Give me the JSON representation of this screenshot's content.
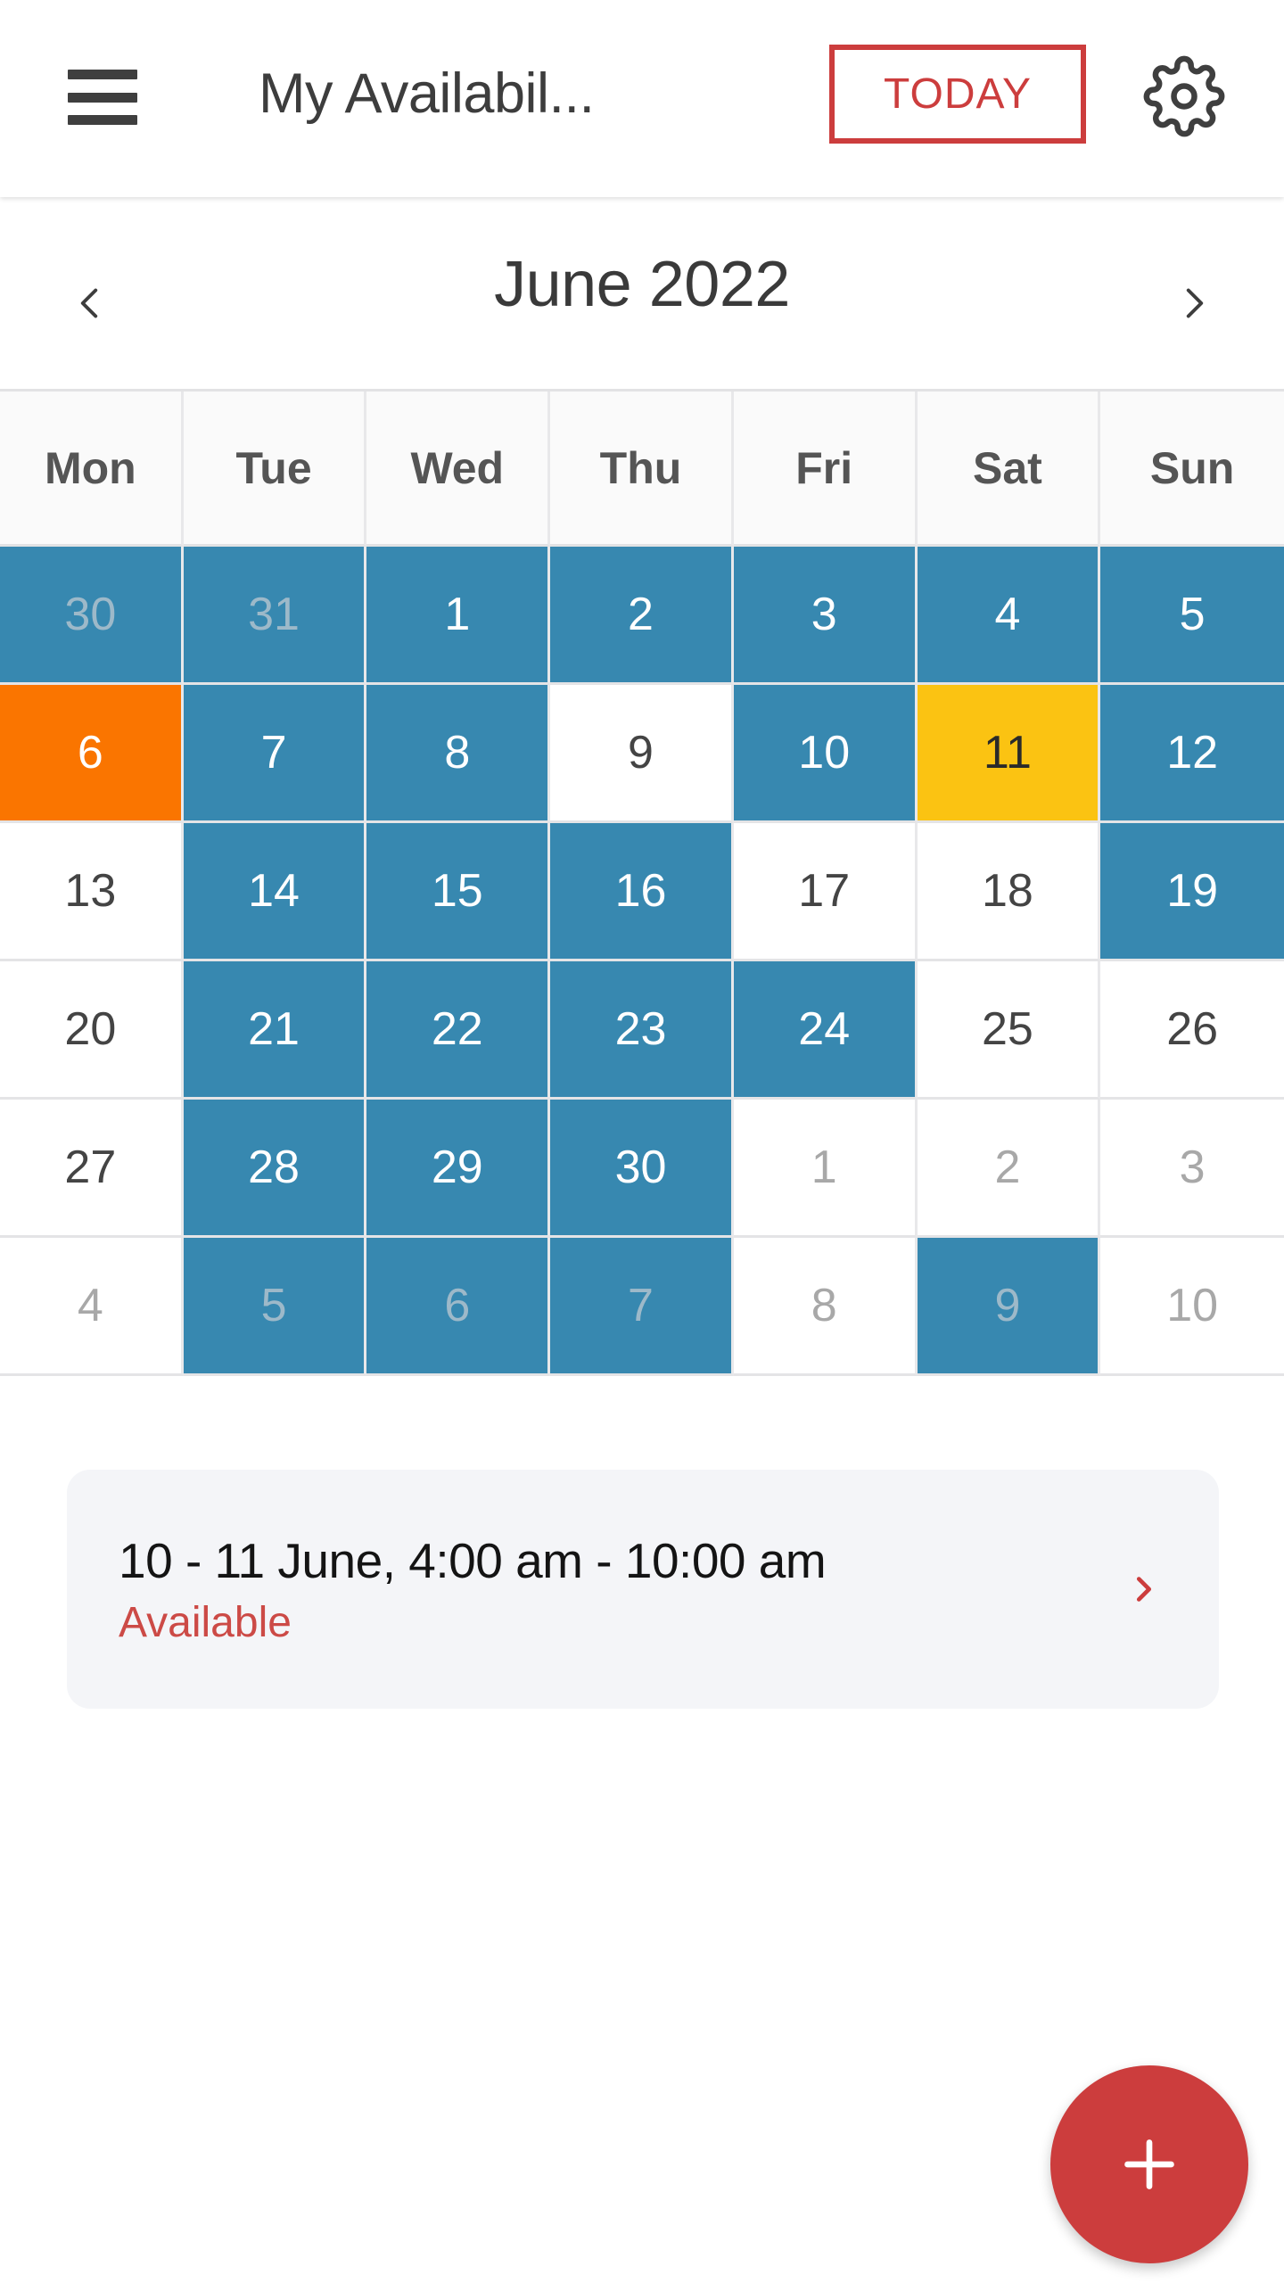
{
  "toolbar": {
    "menu_icon": "hamburger-menu-icon",
    "title": "My Availabil...",
    "today_label": "TODAY",
    "settings_icon": "gear-icon"
  },
  "month_nav": {
    "prev_icon": "chevron-left-icon",
    "next_icon": "chevron-right-icon",
    "label": "June 2022"
  },
  "calendar": {
    "weekdays": [
      "Mon",
      "Tue",
      "Wed",
      "Thu",
      "Fri",
      "Sat",
      "Sun"
    ],
    "weeks": [
      [
        {
          "day": "30",
          "state": "out-blue"
        },
        {
          "day": "31",
          "state": "out-blue"
        },
        {
          "day": "1",
          "state": "st-blue"
        },
        {
          "day": "2",
          "state": "st-blue"
        },
        {
          "day": "3",
          "state": "st-blue"
        },
        {
          "day": "4",
          "state": "st-blue"
        },
        {
          "day": "5",
          "state": "st-blue"
        }
      ],
      [
        {
          "day": "6",
          "state": "st-orange"
        },
        {
          "day": "7",
          "state": "st-blue"
        },
        {
          "day": "8",
          "state": "st-blue"
        },
        {
          "day": "9",
          "state": "st-default"
        },
        {
          "day": "10",
          "state": "st-blue"
        },
        {
          "day": "11",
          "state": "st-yellow"
        },
        {
          "day": "12",
          "state": "st-blue"
        }
      ],
      [
        {
          "day": "13",
          "state": "st-default"
        },
        {
          "day": "14",
          "state": "st-blue"
        },
        {
          "day": "15",
          "state": "st-blue"
        },
        {
          "day": "16",
          "state": "st-blue"
        },
        {
          "day": "17",
          "state": "st-default"
        },
        {
          "day": "18",
          "state": "st-default"
        },
        {
          "day": "19",
          "state": "st-blue"
        }
      ],
      [
        {
          "day": "20",
          "state": "st-default"
        },
        {
          "day": "21",
          "state": "st-blue"
        },
        {
          "day": "22",
          "state": "st-blue"
        },
        {
          "day": "23",
          "state": "st-blue"
        },
        {
          "day": "24",
          "state": "st-blue"
        },
        {
          "day": "25",
          "state": "st-default"
        },
        {
          "day": "26",
          "state": "st-default"
        }
      ],
      [
        {
          "day": "27",
          "state": "st-default"
        },
        {
          "day": "28",
          "state": "st-blue"
        },
        {
          "day": "29",
          "state": "st-blue"
        },
        {
          "day": "30",
          "state": "st-blue"
        },
        {
          "day": "1",
          "state": "out-default"
        },
        {
          "day": "2",
          "state": "out-default"
        },
        {
          "day": "3",
          "state": "out-default"
        }
      ],
      [
        {
          "day": "4",
          "state": "out-default"
        },
        {
          "day": "5",
          "state": "out-blue"
        },
        {
          "day": "6",
          "state": "out-blue"
        },
        {
          "day": "7",
          "state": "out-blue"
        },
        {
          "day": "8",
          "state": "out-default"
        },
        {
          "day": "9",
          "state": "out-blue"
        },
        {
          "day": "10",
          "state": "out-default"
        }
      ]
    ]
  },
  "event": {
    "title": "10 - 11 June, 4:00 am - 10:00 am",
    "status": "Available",
    "chevron_icon": "chevron-right-icon"
  },
  "fab": {
    "icon": "plus-icon",
    "label": "+"
  },
  "colors": {
    "accent_red": "#cc3d3d",
    "available_blue": "#3788b0",
    "orange": "#fa7500",
    "yellow": "#fbc312",
    "card_bg": "#f4f5f8",
    "text_dark": "#3d3d3d"
  }
}
